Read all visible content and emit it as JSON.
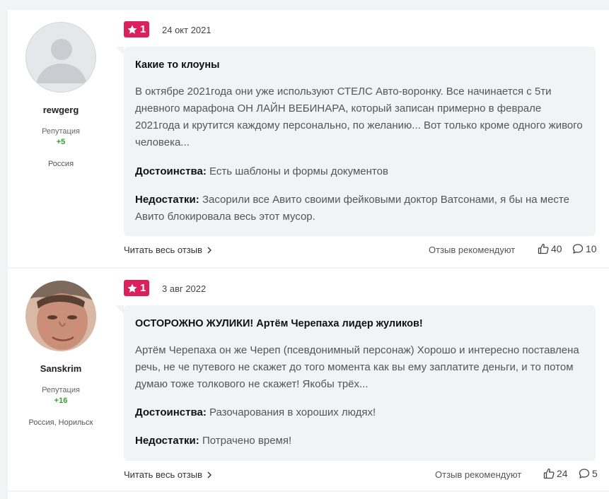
{
  "reviews": [
    {
      "user": {
        "name": "rewgerg",
        "reputation_label": "Репутация",
        "reputation": "+5",
        "location": "Россия",
        "avatar": "default-avatar-icon"
      },
      "rating": "1",
      "date": "24 окт 2021",
      "title": "Какие то клоуны",
      "body": "В октябре 2021года они уже используют СТЕЛС Авто-воронку. Все начинается с 5ти дневного марафона ОН ЛАЙН ВЕБИНАРА, который записан примерно в феврале 2021года и крутится каждому персонально, по желанию... Вот только кроме одного живого человека...",
      "pros_label": "Достоинства:",
      "pros": "Есть шаблоны и формы документов",
      "cons_label": "Недостатки:",
      "cons": "Засорили все Авито своими фейковыми доктор Ватсонами, я бы на месте Авито блокировала весь этот мусор.",
      "read_more": "Читать весь отзыв",
      "recommend": "Отзыв рекомендуют",
      "likes": "40",
      "comments": "10"
    },
    {
      "user": {
        "name": "Sanskrim",
        "reputation_label": "Репутация",
        "reputation": "+16",
        "location": "Россия, Норильск",
        "avatar": "user-photo"
      },
      "rating": "1",
      "date": "3 авг 2022",
      "title": "ОСТОРОЖНО ЖУЛИКИ! Артём Черепаха лидер жуликов!",
      "body": "Артём Черепаха он же Череп (псевдонимный персонаж) Хорошо и интересно поставлена речь, не че путевого не скажет до того момента как вы ему заплатите деньги, и то потом думаю тоже толкового не скажет! Якобы трёх...",
      "pros_label": "Достоинства:",
      "pros": "Разочарования в хороших людях!",
      "cons_label": "Недостатки:",
      "cons": "Потрачено время!",
      "read_more": "Читать весь отзыв",
      "recommend": "Отзыв рекомендуют",
      "likes": "24",
      "comments": "5"
    }
  ],
  "colors": {
    "rating_badge": "#d9215c",
    "reputation": "#2e9e2e",
    "card_bg": "#f2f3f5"
  }
}
